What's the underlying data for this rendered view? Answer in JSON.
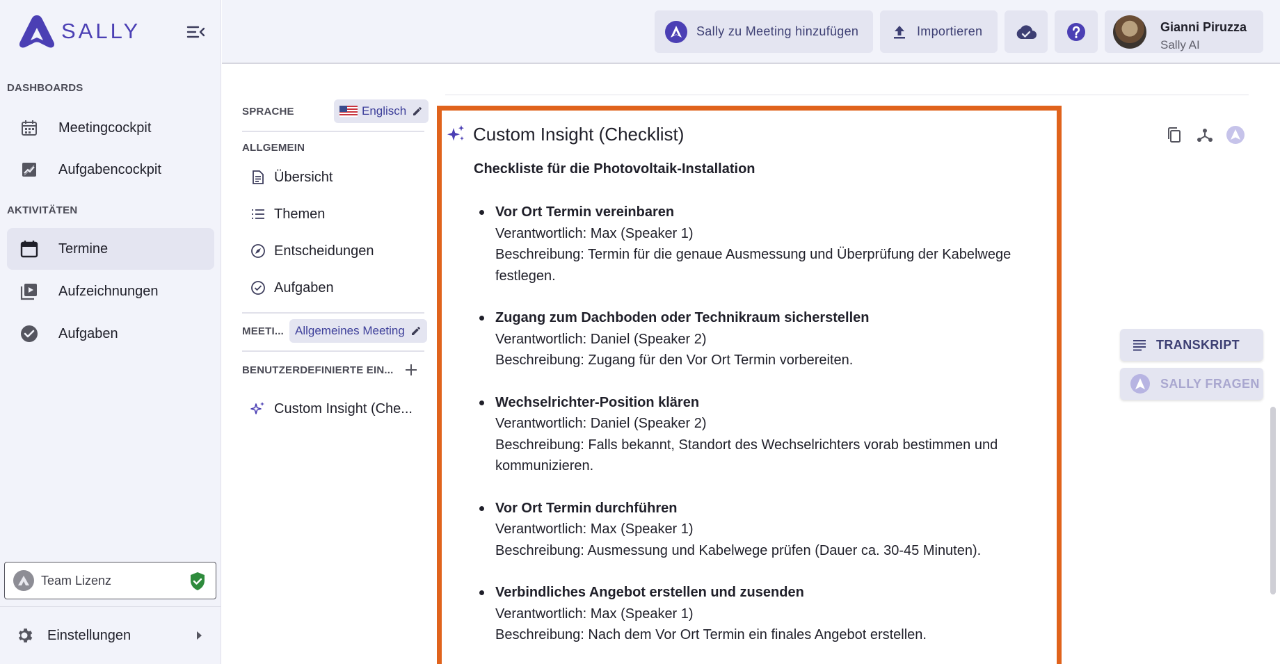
{
  "brand": {
    "name": "SALLY"
  },
  "sidebar": {
    "section_dashboards": "DASHBOARDS",
    "section_activities": "AKTIVITÄTEN",
    "items": [
      {
        "label": "Meetingcockpit",
        "icon": "calendar-grid-icon"
      },
      {
        "label": "Aufgabencockpit",
        "icon": "chart-icon"
      },
      {
        "label": "Termine",
        "icon": "calendar-icon",
        "active": true
      },
      {
        "label": "Aufzeichnungen",
        "icon": "video-library-icon"
      },
      {
        "label": "Aufgaben",
        "icon": "check-circle-icon"
      }
    ],
    "license_label": "Team Lizenz",
    "settings_label": "Einstellungen"
  },
  "topbar": {
    "add_meeting_label": "Sally zu Meeting hinzufügen",
    "import_label": "Importieren",
    "user_name": "Gianni Piruzza",
    "user_role": "Sally AI"
  },
  "panel": {
    "language_label": "SPRACHE",
    "language_value": "Englisch",
    "general_label": "ALLGEMEIN",
    "menu": [
      {
        "label": "Übersicht",
        "icon": "document-icon"
      },
      {
        "label": "Themen",
        "icon": "list-icon"
      },
      {
        "label": "Entscheidungen",
        "icon": "compass-icon"
      },
      {
        "label": "Aufgaben",
        "icon": "check-circle-outline-icon"
      }
    ],
    "meeting_label": "MEETI...",
    "meeting_value": "Allgemeines Meeting",
    "custom_label": "BENUTZERDEFINIERTE EIN...",
    "custom_item": "Custom Insight (Che..."
  },
  "insight": {
    "title": "Custom Insight (Checklist)",
    "heading": "Checkliste für die Photovoltaik-Installation",
    "items": [
      {
        "title": "Vor Ort Termin vereinbaren",
        "owner": "Verantwortlich: Max (Speaker 1)",
        "desc": "Beschreibung: Termin für die genaue Ausmessung und Überprüfung der Kabelwege festlegen."
      },
      {
        "title": "Zugang zum Dachboden oder Technikraum sicherstellen",
        "owner": "Verantwortlich: Daniel (Speaker 2)",
        "desc": "Beschreibung: Zugang für den Vor Ort Termin vorbereiten."
      },
      {
        "title": "Wechselrichter-Position klären",
        "owner": "Verantwortlich: Daniel (Speaker 2)",
        "desc": "Beschreibung: Falls bekannt, Standort des Wechselrichters vorab bestimmen und kommunizieren."
      },
      {
        "title": "Vor Ort Termin durchführen",
        "owner": "Verantwortlich: Max (Speaker 1)",
        "desc": "Beschreibung: Ausmessung und Kabelwege prüfen (Dauer ca. 30-45 Minuten)."
      },
      {
        "title": "Verbindliches Angebot erstellen und zusenden",
        "owner": "Verantwortlich: Max (Speaker 1)",
        "desc": "Beschreibung: Nach dem Vor Ort Termin ein finales Angebot erstellen."
      }
    ]
  },
  "right": {
    "transcript_label": "TRANSKRIPT",
    "ask_label": "SALLY FRAGEN"
  },
  "colors": {
    "brand": "#4b3fb4",
    "highlight_border": "#e0631c",
    "license_ok": "#2e8b3c"
  }
}
